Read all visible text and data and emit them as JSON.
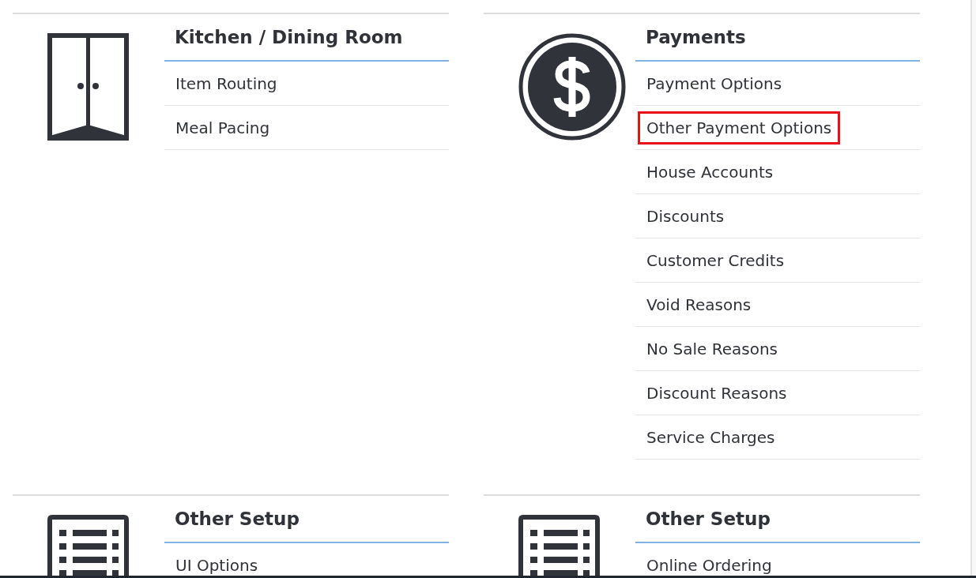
{
  "sections": [
    {
      "kind": "doors",
      "title": "Kitchen / Dining Room",
      "items": [
        {
          "label": "Item Routing",
          "highlighted": false
        },
        {
          "label": "Meal Pacing",
          "highlighted": false
        }
      ]
    },
    {
      "kind": "dollar",
      "title": "Payments",
      "items": [
        {
          "label": "Payment Options",
          "highlighted": false
        },
        {
          "label": "Other Payment Options",
          "highlighted": true
        },
        {
          "label": "House Accounts",
          "highlighted": false
        },
        {
          "label": "Discounts",
          "highlighted": false
        },
        {
          "label": "Customer Credits",
          "highlighted": false
        },
        {
          "label": "Void Reasons",
          "highlighted": false
        },
        {
          "label": "No Sale Reasons",
          "highlighted": false
        },
        {
          "label": "Discount Reasons",
          "highlighted": false
        },
        {
          "label": "Service Charges",
          "highlighted": false
        }
      ]
    },
    {
      "kind": "list",
      "title": "Other Setup",
      "items": [
        {
          "label": "UI Options",
          "highlighted": false
        }
      ]
    },
    {
      "kind": "list",
      "title": "Other Setup",
      "items": [
        {
          "label": "Online Ordering",
          "highlighted": false
        }
      ]
    }
  ]
}
